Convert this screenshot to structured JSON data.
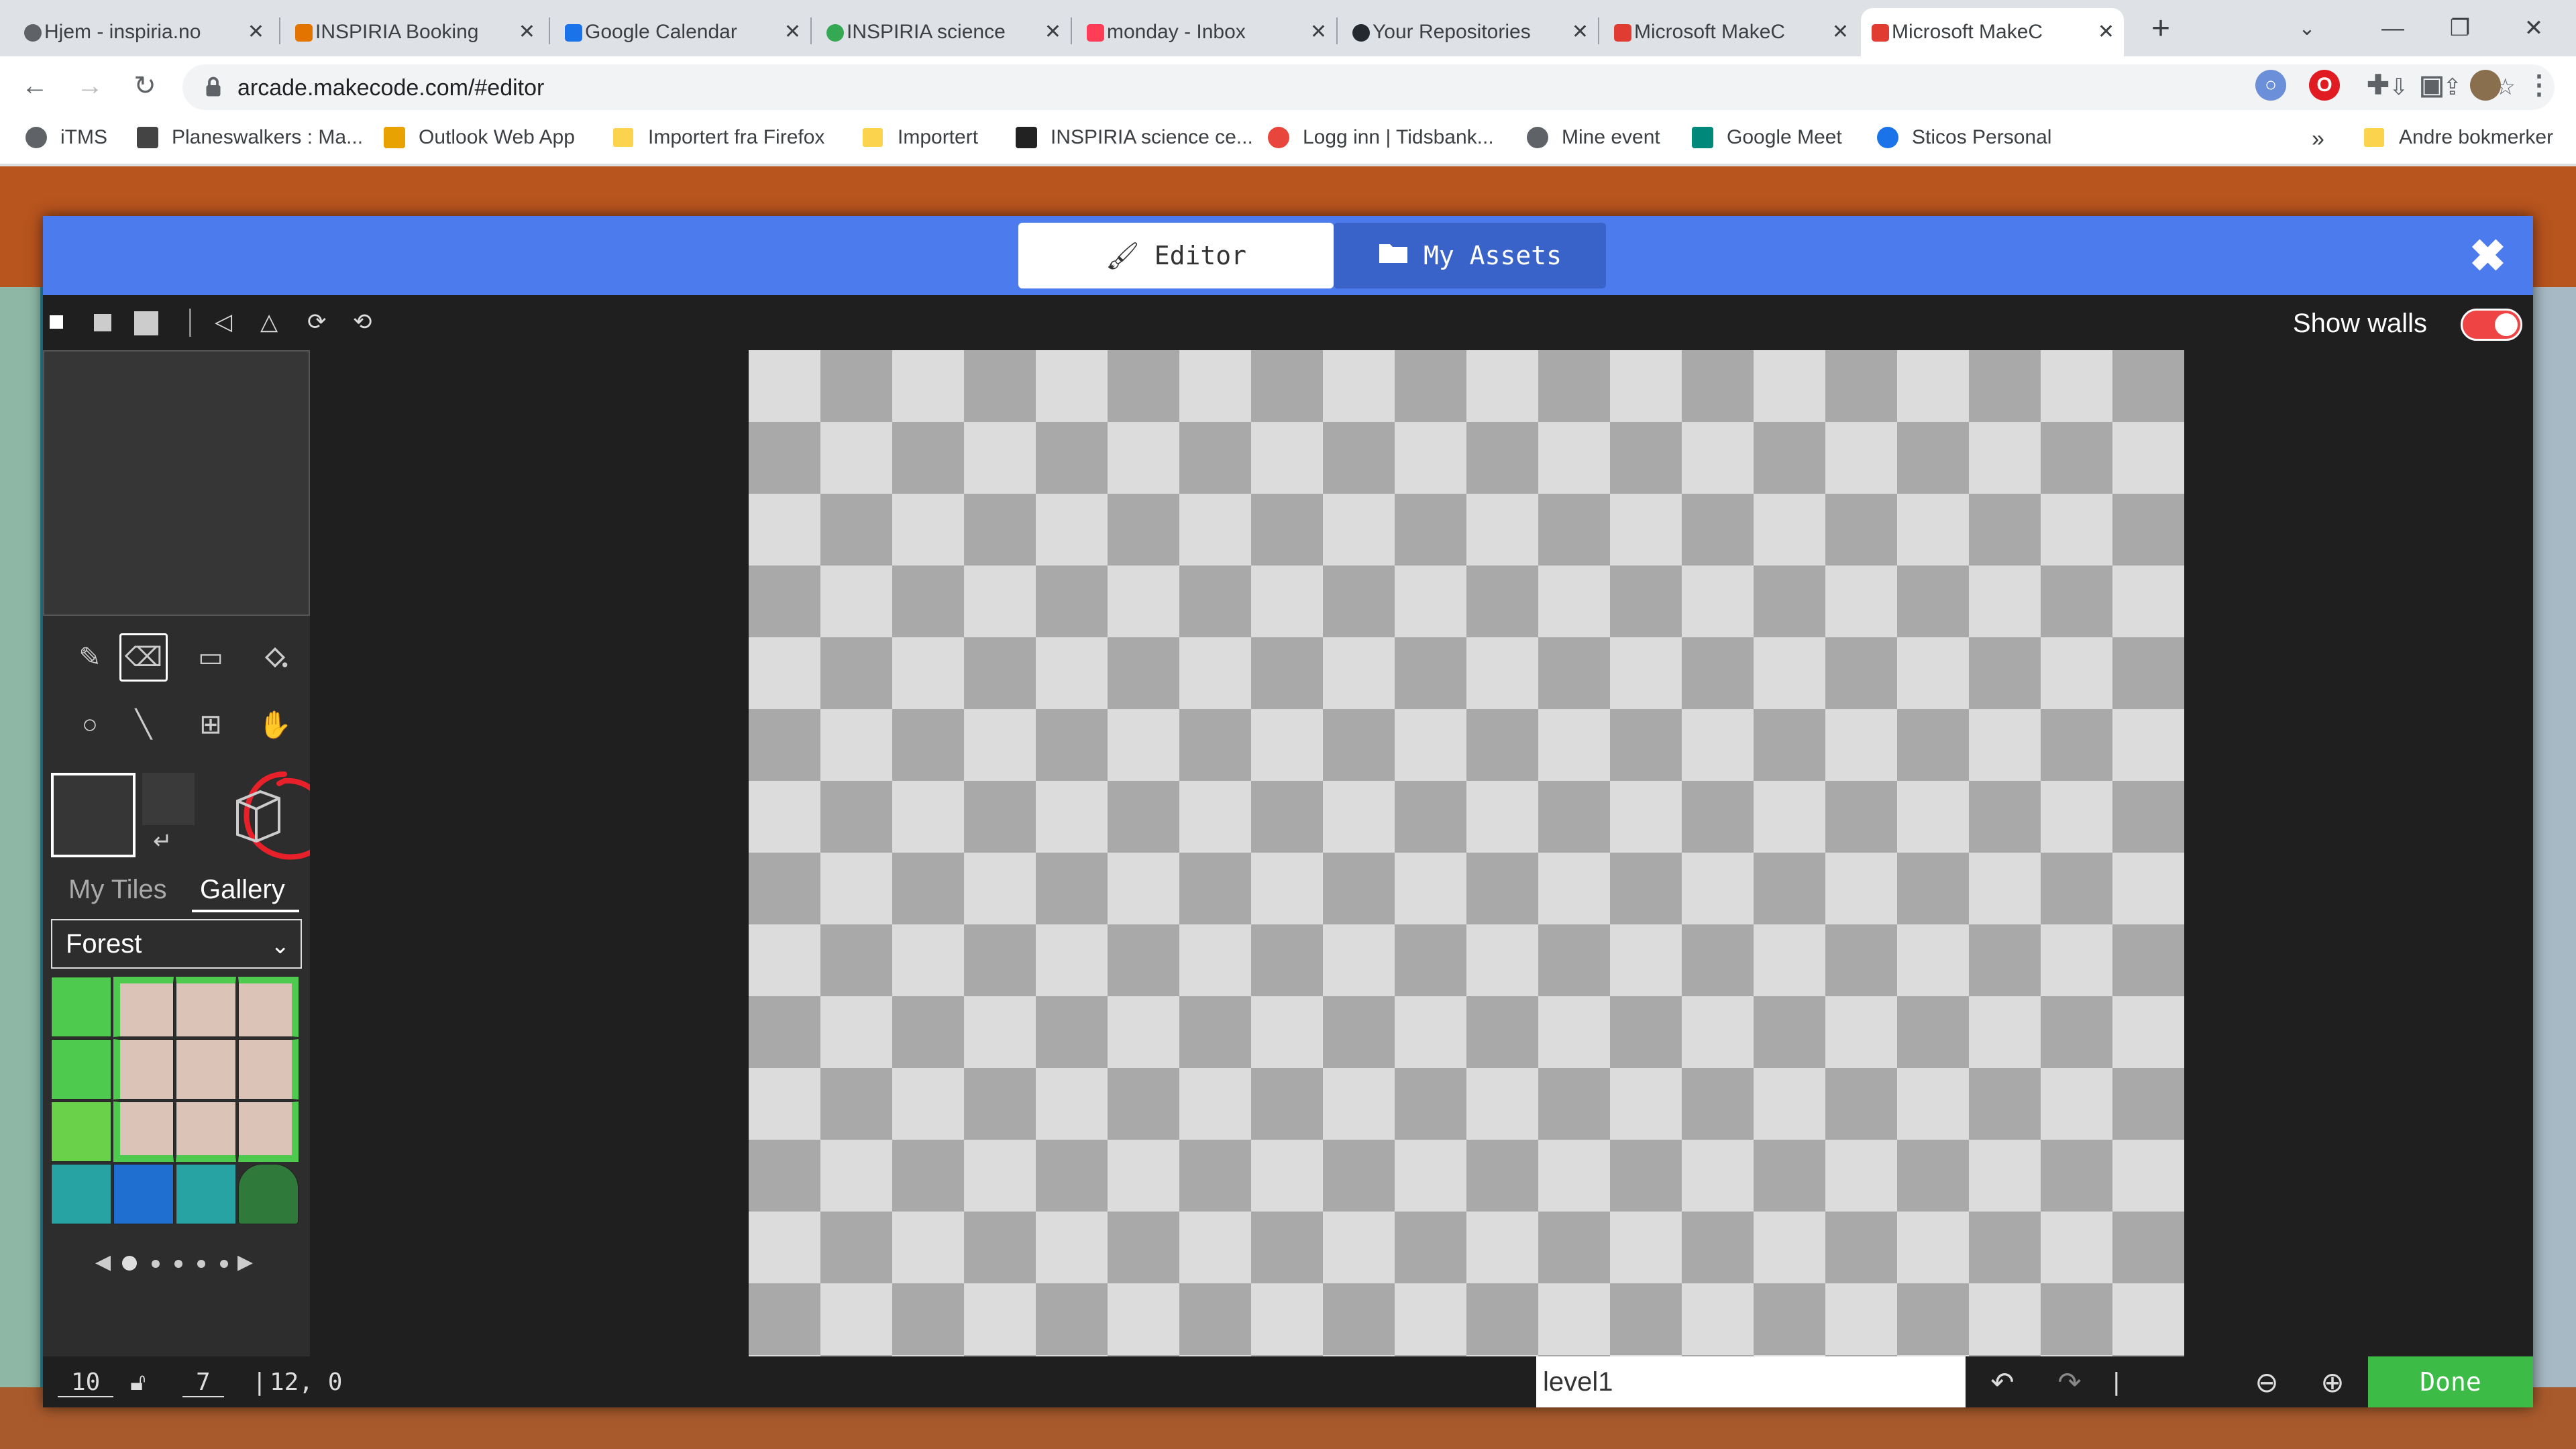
{
  "browser": {
    "tabs": [
      {
        "title": "Hjem - inspiria.no",
        "favicon_color": "#5f6368",
        "active": false
      },
      {
        "title": "INSPIRIA Booking",
        "favicon_color": "#e37400",
        "active": false
      },
      {
        "title": "Google Calendar",
        "favicon_color": "#1a73e8",
        "active": false
      },
      {
        "title": "INSPIRIA science",
        "favicon_color": "#34a853",
        "active": false
      },
      {
        "title": "monday - Inbox",
        "favicon_color": "#ff3d57",
        "active": false
      },
      {
        "title": "Your Repositories",
        "favicon_color": "#24292f",
        "active": false
      },
      {
        "title": "Microsoft MakeC",
        "favicon_color": "#e03c31",
        "active": false
      },
      {
        "title": "Microsoft MakeC",
        "favicon_color": "#e03c31",
        "active": true
      }
    ],
    "new_tab": "+",
    "url": "arcade.makecode.com/#editor",
    "bookmarks": [
      {
        "label": "iTMS",
        "icon": "globe-icon"
      },
      {
        "label": "Planeswalkers : Ma...",
        "icon": "hat-icon"
      },
      {
        "label": "Outlook Web App",
        "icon": "outlook-icon"
      },
      {
        "label": "Importert fra Firefox",
        "icon": "folder-icon"
      },
      {
        "label": "Importert",
        "icon": "folder-icon"
      },
      {
        "label": "INSPIRIA science ce...",
        "icon": "inspiria-icon"
      },
      {
        "label": "Logg inn | Tidsbank...",
        "icon": "tidsbank-icon"
      },
      {
        "label": "Mine event",
        "icon": "globe-icon"
      },
      {
        "label": "Google Meet",
        "icon": "meet-icon"
      },
      {
        "label": "Sticos Personal",
        "icon": "sticos-icon"
      }
    ],
    "bookmarks_overflow": "»",
    "other_bookmarks": "Andre bokmerker"
  },
  "editor": {
    "tab_editor": "Editor",
    "tab_assets": "My Assets",
    "show_walls_label": "Show walls",
    "show_walls_on": true,
    "gallery_tabs": {
      "my_tiles": "My Tiles",
      "gallery": "Gallery"
    },
    "category": "Forest",
    "selected_tool": "eraser",
    "bottom": {
      "width": "10",
      "height": "7",
      "cursor": "12, 0",
      "level_name": "level1",
      "done": "Done"
    }
  },
  "colors": {
    "header_blue": "#4b7bec",
    "done_green": "#3dbb47",
    "toggle_red": "#e44444",
    "annotation_red": "#e8202a"
  }
}
